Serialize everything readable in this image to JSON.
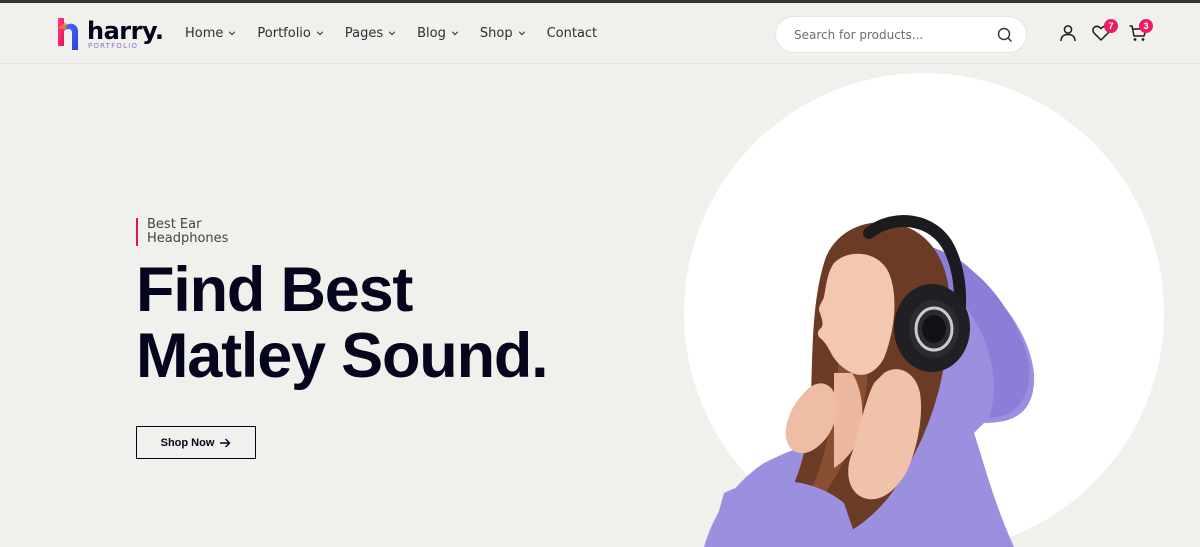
{
  "brand": {
    "name": "harry.",
    "tagline": "PORTFOLIO",
    "colors": {
      "pink": "#e8105b",
      "blue": "#3a5bff",
      "purple": "#8f6fd6"
    }
  },
  "nav": {
    "items": [
      {
        "label": "Home",
        "has_dropdown": true
      },
      {
        "label": "Portfolio",
        "has_dropdown": true
      },
      {
        "label": "Pages",
        "has_dropdown": true
      },
      {
        "label": "Blog",
        "has_dropdown": true
      },
      {
        "label": "Shop",
        "has_dropdown": true
      },
      {
        "label": "Contact",
        "has_dropdown": false
      }
    ]
  },
  "search": {
    "placeholder": "Search for products...",
    "icon": "search-icon"
  },
  "header_actions": {
    "user_icon": "user-icon",
    "wishlist": {
      "icon": "heart-icon",
      "count": "7"
    },
    "cart": {
      "icon": "cart-icon",
      "count": "3"
    }
  },
  "hero": {
    "subtitle_line1": "Best Ear",
    "subtitle_line2": "Headphones",
    "title_line1": "Find Best",
    "title_line2": "Matley Sound.",
    "cta_label": "Shop Now",
    "cta_icon": "arrow-right-icon",
    "image": "woman-wearing-headphones-in-purple-hoodie"
  },
  "colors": {
    "background": "#f0f0ec",
    "text_dark": "#03041c",
    "badge": "#ed1c65",
    "hoodie": "#9b8fe0"
  }
}
